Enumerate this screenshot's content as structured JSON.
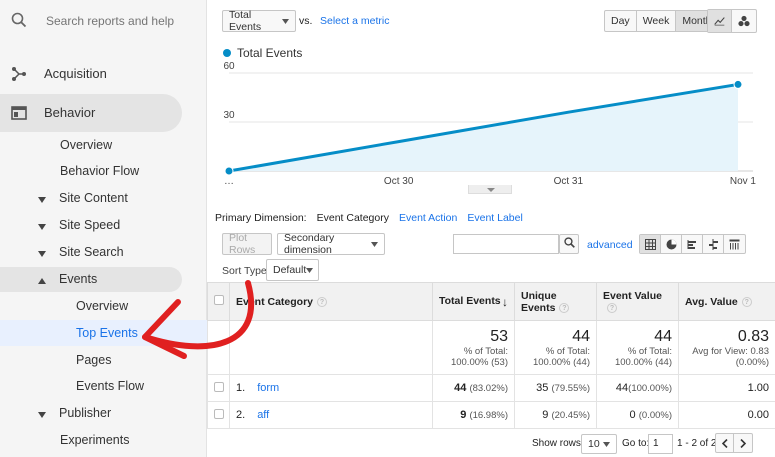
{
  "sidebar": {
    "search_placeholder": "Search reports and help",
    "top_items": [
      {
        "label": "Acquisition"
      },
      {
        "label": "Behavior"
      }
    ],
    "items": [
      {
        "label": "Overview"
      },
      {
        "label": "Behavior Flow"
      },
      {
        "label": "Site Content"
      },
      {
        "label": "Site Speed"
      },
      {
        "label": "Site Search"
      },
      {
        "label": "Events"
      },
      {
        "label": "Overview"
      },
      {
        "label": "Top Events"
      },
      {
        "label": "Pages"
      },
      {
        "label": "Events Flow"
      },
      {
        "label": "Publisher"
      },
      {
        "label": "Experiments"
      }
    ]
  },
  "toolbar": {
    "metric_select": "Total Events",
    "vs_label": "vs.",
    "select_metric_link": "Select a metric",
    "range_buttons": [
      "Day",
      "Week",
      "Month"
    ],
    "active_range": "Month"
  },
  "chart_data": {
    "type": "line",
    "legend": "Total Events",
    "x": [
      "",
      "Oct 30",
      "Oct 31",
      "Nov 1"
    ],
    "first_tick_label": "…",
    "series": [
      {
        "name": "Total Events",
        "values": [
          0,
          18,
          36,
          53
        ]
      }
    ],
    "yticks": [
      30,
      60
    ],
    "ylim": [
      0,
      60
    ],
    "color": "#058dc7",
    "fill": "#e6f4fb"
  },
  "dimensions": {
    "label": "Primary Dimension:",
    "items": [
      "Event Category",
      "Event Action",
      "Event Label"
    ],
    "active": "Event Category"
  },
  "controls": {
    "plot_rows": "Plot Rows",
    "secondary_dimension": "Secondary dimension",
    "advanced": "advanced",
    "sort_type_label": "Sort Type:",
    "sort_type_value": "Default"
  },
  "table": {
    "headers": [
      "Event Category",
      "Total Events",
      "Unique Events",
      "Event Value",
      "Avg. Value"
    ],
    "totals": {
      "total_events": "53",
      "total_events_sub": "% of Total: 100.00% (53)",
      "unique_events": "44",
      "unique_events_sub": "% of Total: 100.00% (44)",
      "event_value": "44",
      "event_value_sub": "% of Total: 100.00% (44)",
      "avg_value": "0.83",
      "avg_value_sub": "Avg for View: 0.83 (0.00%)"
    },
    "rows": [
      {
        "index": "1.",
        "category": "form",
        "total": "44",
        "total_pct": "(83.02%)",
        "unique": "35",
        "unique_pct": "(79.55%)",
        "value": "44",
        "value_pct": "(100.00%)",
        "avg": "1.00"
      },
      {
        "index": "2.",
        "category": "aff",
        "total": "9",
        "total_pct": "(16.98%)",
        "unique": "9",
        "unique_pct": "(20.45%)",
        "value": "0",
        "value_pct": "(0.00%)",
        "avg": "0.00"
      }
    ]
  },
  "footer": {
    "show_rows_label": "Show rows:",
    "show_rows_value": "10",
    "goto_label": "Go to:",
    "goto_value": "1",
    "range_text": "1 - 2 of 2"
  },
  "colors": {
    "annotation_arrow": "#e02020",
    "link": "#1a73e8",
    "accent": "#058dc7"
  }
}
